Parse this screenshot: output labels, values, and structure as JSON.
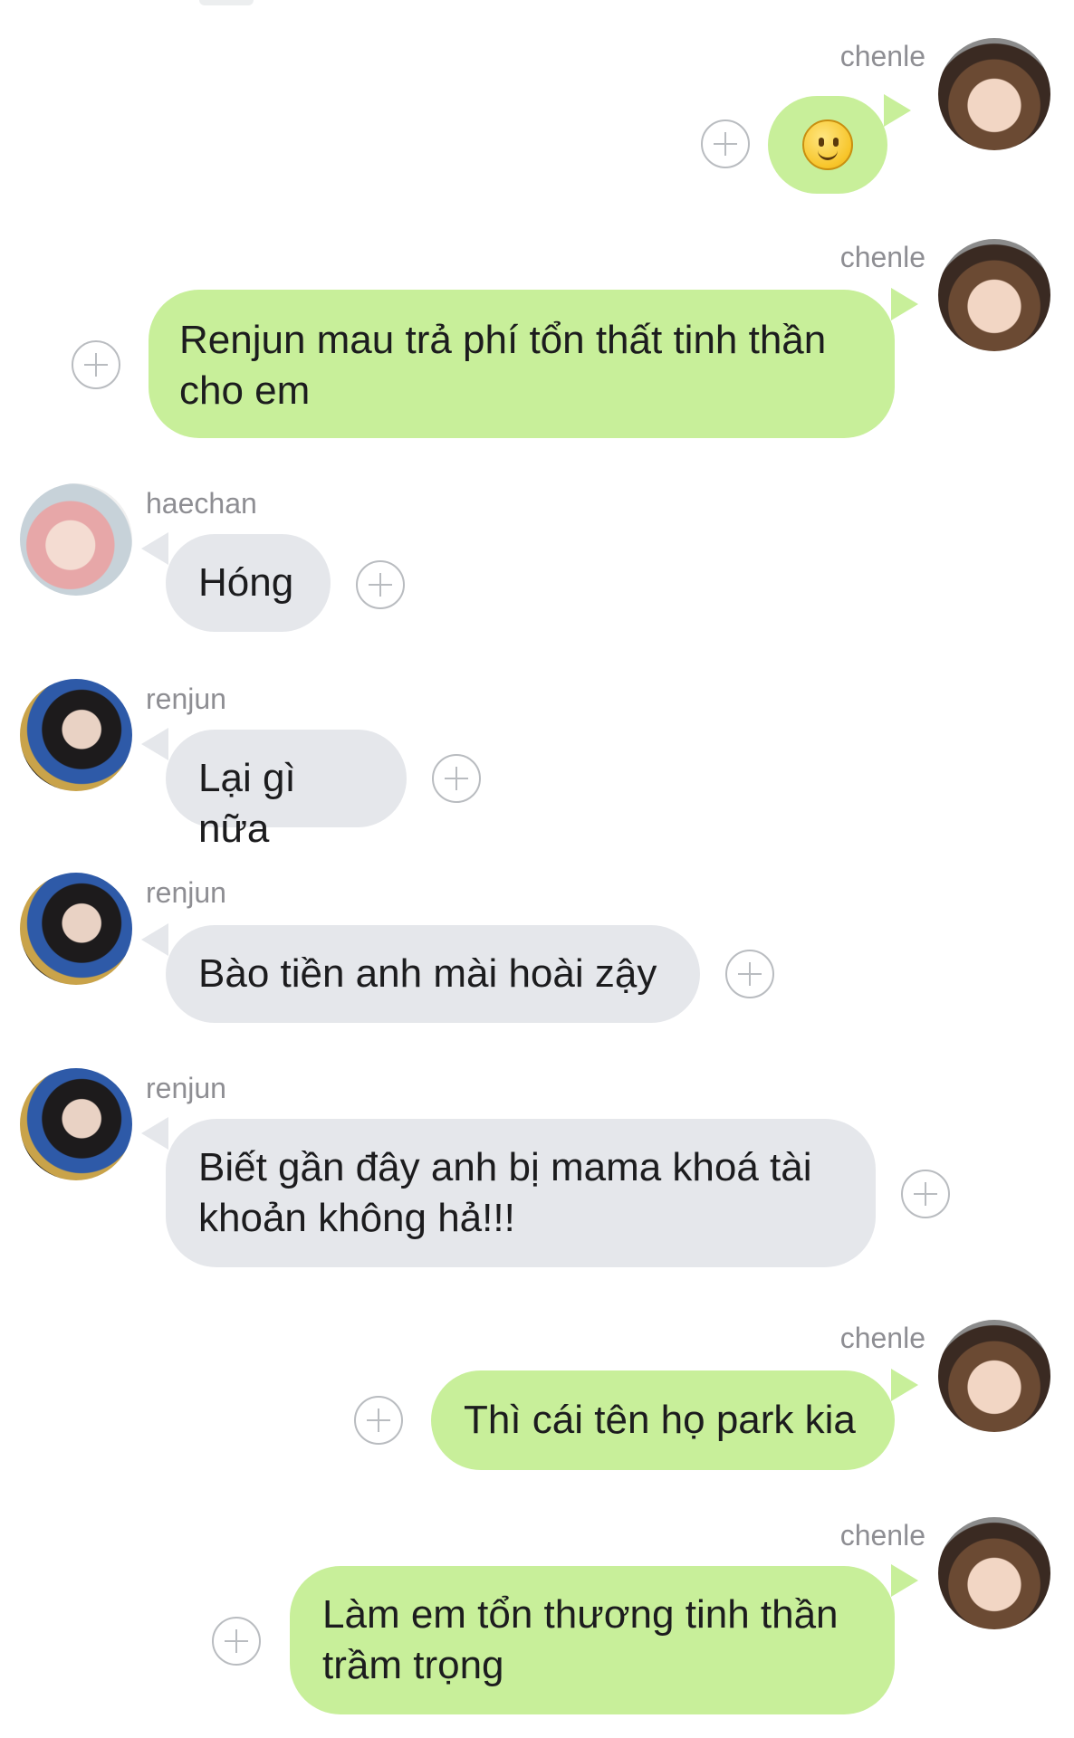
{
  "messages": [
    {
      "sender": "chenle",
      "side": "right",
      "content": "🙂",
      "is_emoji": true
    },
    {
      "sender": "chenle",
      "side": "right",
      "content": "Renjun mau trả phí tổn thất tinh thần\ncho em"
    },
    {
      "sender": "haechan",
      "side": "left",
      "content": "Hóng"
    },
    {
      "sender": "renjun",
      "side": "left",
      "content": "Lại gì nữa"
    },
    {
      "sender": "renjun",
      "side": "left",
      "content": "Bào tiền anh mài hoài zậy"
    },
    {
      "sender": "renjun",
      "side": "left",
      "content": "Biết gần đây anh bị mama khoá tài\nkhoản không hả!!!"
    },
    {
      "sender": "chenle",
      "side": "right",
      "content": "Thì cái tên họ park kia"
    },
    {
      "sender": "chenle",
      "side": "right",
      "content": "Làm em tổn thương tinh thần\ntrầm trọng"
    }
  ],
  "colors": {
    "outgoing_bubble": "#c8ef9a",
    "incoming_bubble": "#e5e7eb",
    "name_text": "#8e8e93",
    "add_reaction_icon": "#b9bcc0"
  },
  "icons": {
    "add_reaction": "plus-circle-icon",
    "emoji": "slightly-smiling-face"
  }
}
